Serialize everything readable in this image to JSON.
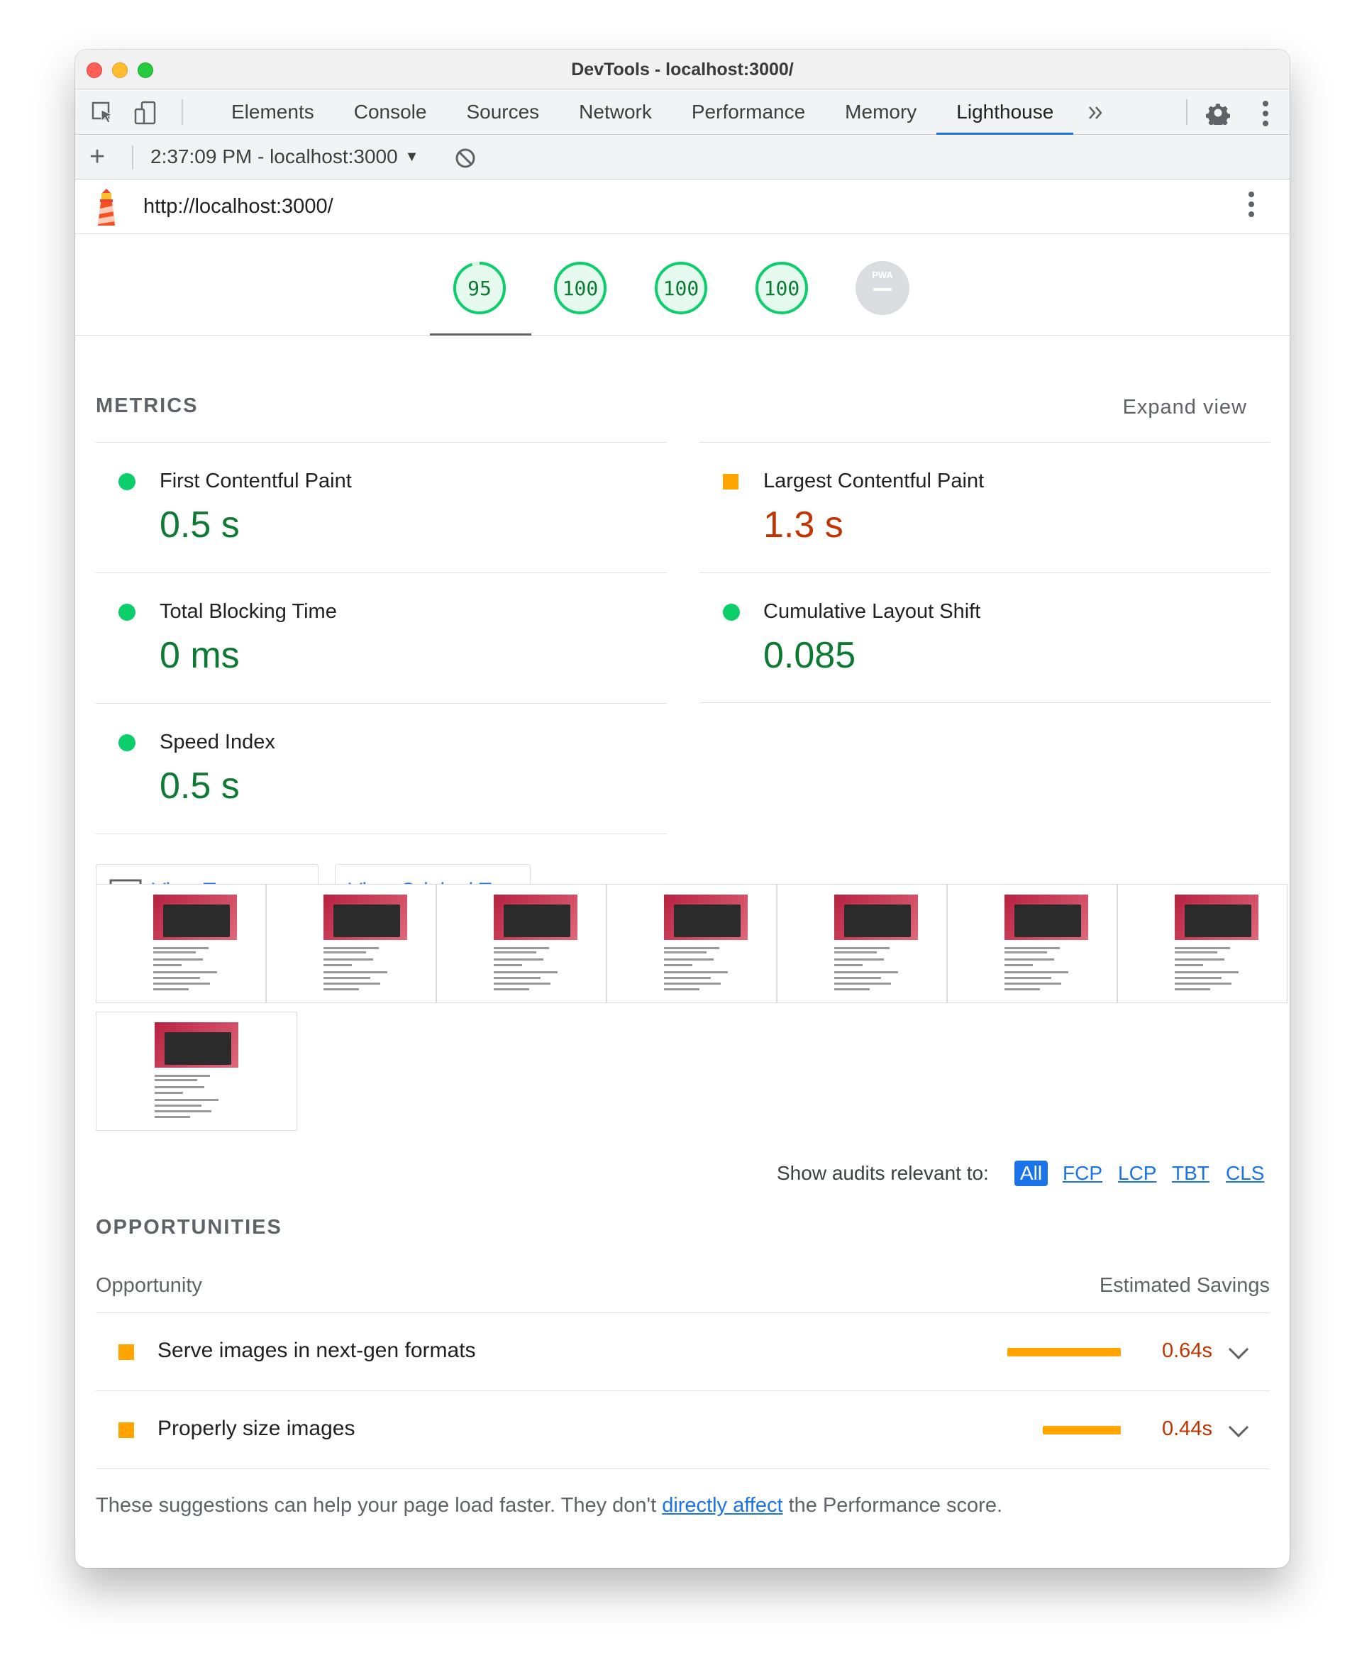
{
  "window": {
    "title": "DevTools - localhost:3000/"
  },
  "tabs": [
    "Elements",
    "Console",
    "Sources",
    "Network",
    "Performance",
    "Memory",
    "Lighthouse"
  ],
  "active_tab": "Lighthouse",
  "toolbar": {
    "report_label": "2:37:09 PM - localhost:3000"
  },
  "report": {
    "url": "http://localhost:3000/"
  },
  "gauges": [
    {
      "label": "95",
      "score": 0.95
    },
    {
      "label": "100",
      "score": 1.0
    },
    {
      "label": "100",
      "score": 1.0
    },
    {
      "label": "100",
      "score": 1.0
    },
    {
      "label": "PWA"
    }
  ],
  "metrics": {
    "title": "METRICS",
    "expand_label": "Expand view",
    "items": [
      {
        "label": "First Contentful Paint",
        "value": "0.5 s",
        "status": "pass"
      },
      {
        "label": "Largest Contentful Paint",
        "value": "1.3 s",
        "status": "average"
      },
      {
        "label": "Total Blocking Time",
        "value": "0 ms",
        "status": "pass"
      },
      {
        "label": "Cumulative Layout Shift",
        "value": "0.085",
        "status": "pass"
      },
      {
        "label": "Speed Index",
        "value": "0.5 s",
        "status": "pass"
      }
    ]
  },
  "buttons": {
    "treemap": "View Treemap",
    "trace": "View Original Trace"
  },
  "filter": {
    "label": "Show audits relevant to:",
    "options": [
      "All",
      "FCP",
      "LCP",
      "TBT",
      "CLS"
    ],
    "active": "All"
  },
  "opportunities": {
    "title": "OPPORTUNITIES",
    "col_opportunity": "Opportunity",
    "col_savings": "Estimated Savings",
    "items": [
      {
        "title": "Serve images in next-gen formats",
        "savings": "0.64s",
        "fraction": 0.64
      },
      {
        "title": "Properly size images",
        "savings": "0.44s",
        "fraction": 0.44
      }
    ]
  },
  "footer": {
    "before": "These suggestions can help your page load faster. They don't ",
    "link": "directly affect",
    "after": " the Performance score."
  },
  "colors": {
    "pass": "#0cce6b",
    "average": "#ffa400",
    "link": "#1a73e8",
    "avg_text": "#c33300"
  }
}
